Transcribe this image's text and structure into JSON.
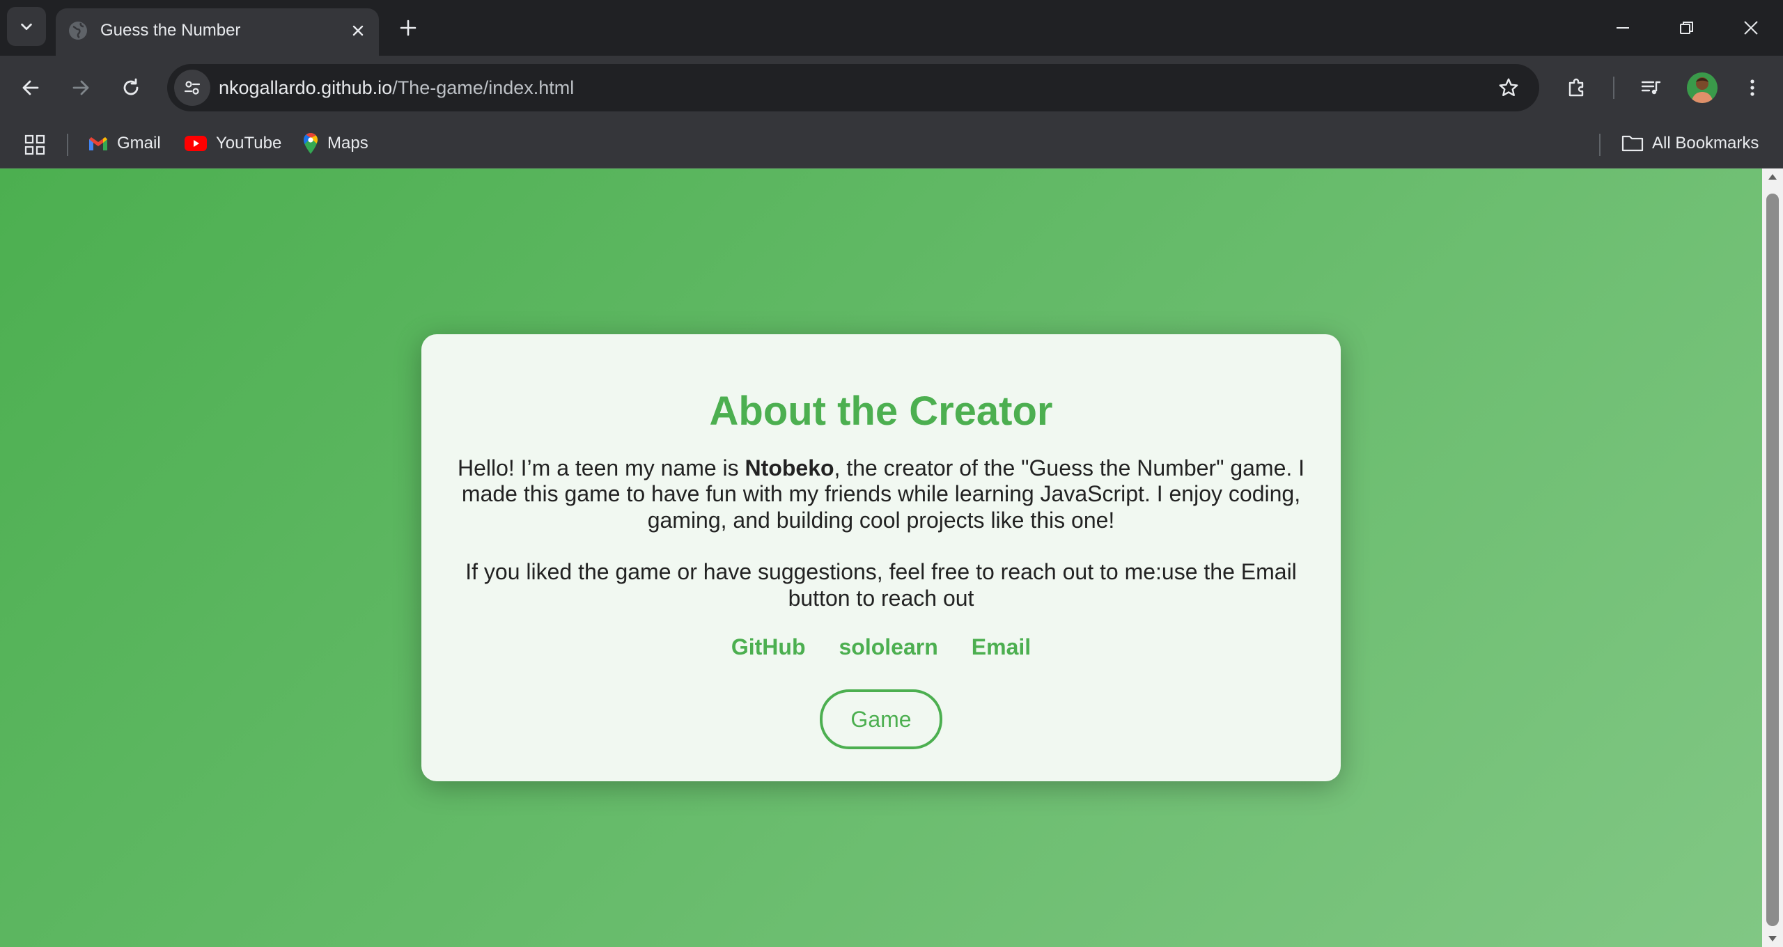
{
  "browser": {
    "tab": {
      "title": "Guess the Number",
      "favicon": "globe-icon"
    },
    "address_bar": {
      "host": "nkogallardo.github.io",
      "path": "/The-game/index.html"
    },
    "bookmarks": {
      "items": [
        {
          "label": "Gmail",
          "icon": "gmail-icon"
        },
        {
          "label": "YouTube",
          "icon": "youtube-icon"
        },
        {
          "label": "Maps",
          "icon": "maps-icon"
        }
      ],
      "all_bookmarks_label": "All Bookmarks"
    }
  },
  "page": {
    "card": {
      "title": "About the Creator",
      "intro_before": "Hello! I’m a teen my name is ",
      "creator_name": "Ntobeko",
      "intro_after": ", the creator of the \"Guess the Number\" game. I made this game to have fun with my friends while learning JavaScript. I enjoy coding, gaming, and building cool projects like this one!",
      "contact_text": "If you liked the game or have suggestions, feel free to reach out to me:use the Email button to reach out",
      "links": [
        {
          "label": "GitHub"
        },
        {
          "label": "sololearn"
        },
        {
          "label": "Email"
        }
      ],
      "game_button": "Game"
    },
    "colors": {
      "accent": "#4caf50",
      "card_background": "#f1f8f1",
      "text": "#222222"
    }
  }
}
